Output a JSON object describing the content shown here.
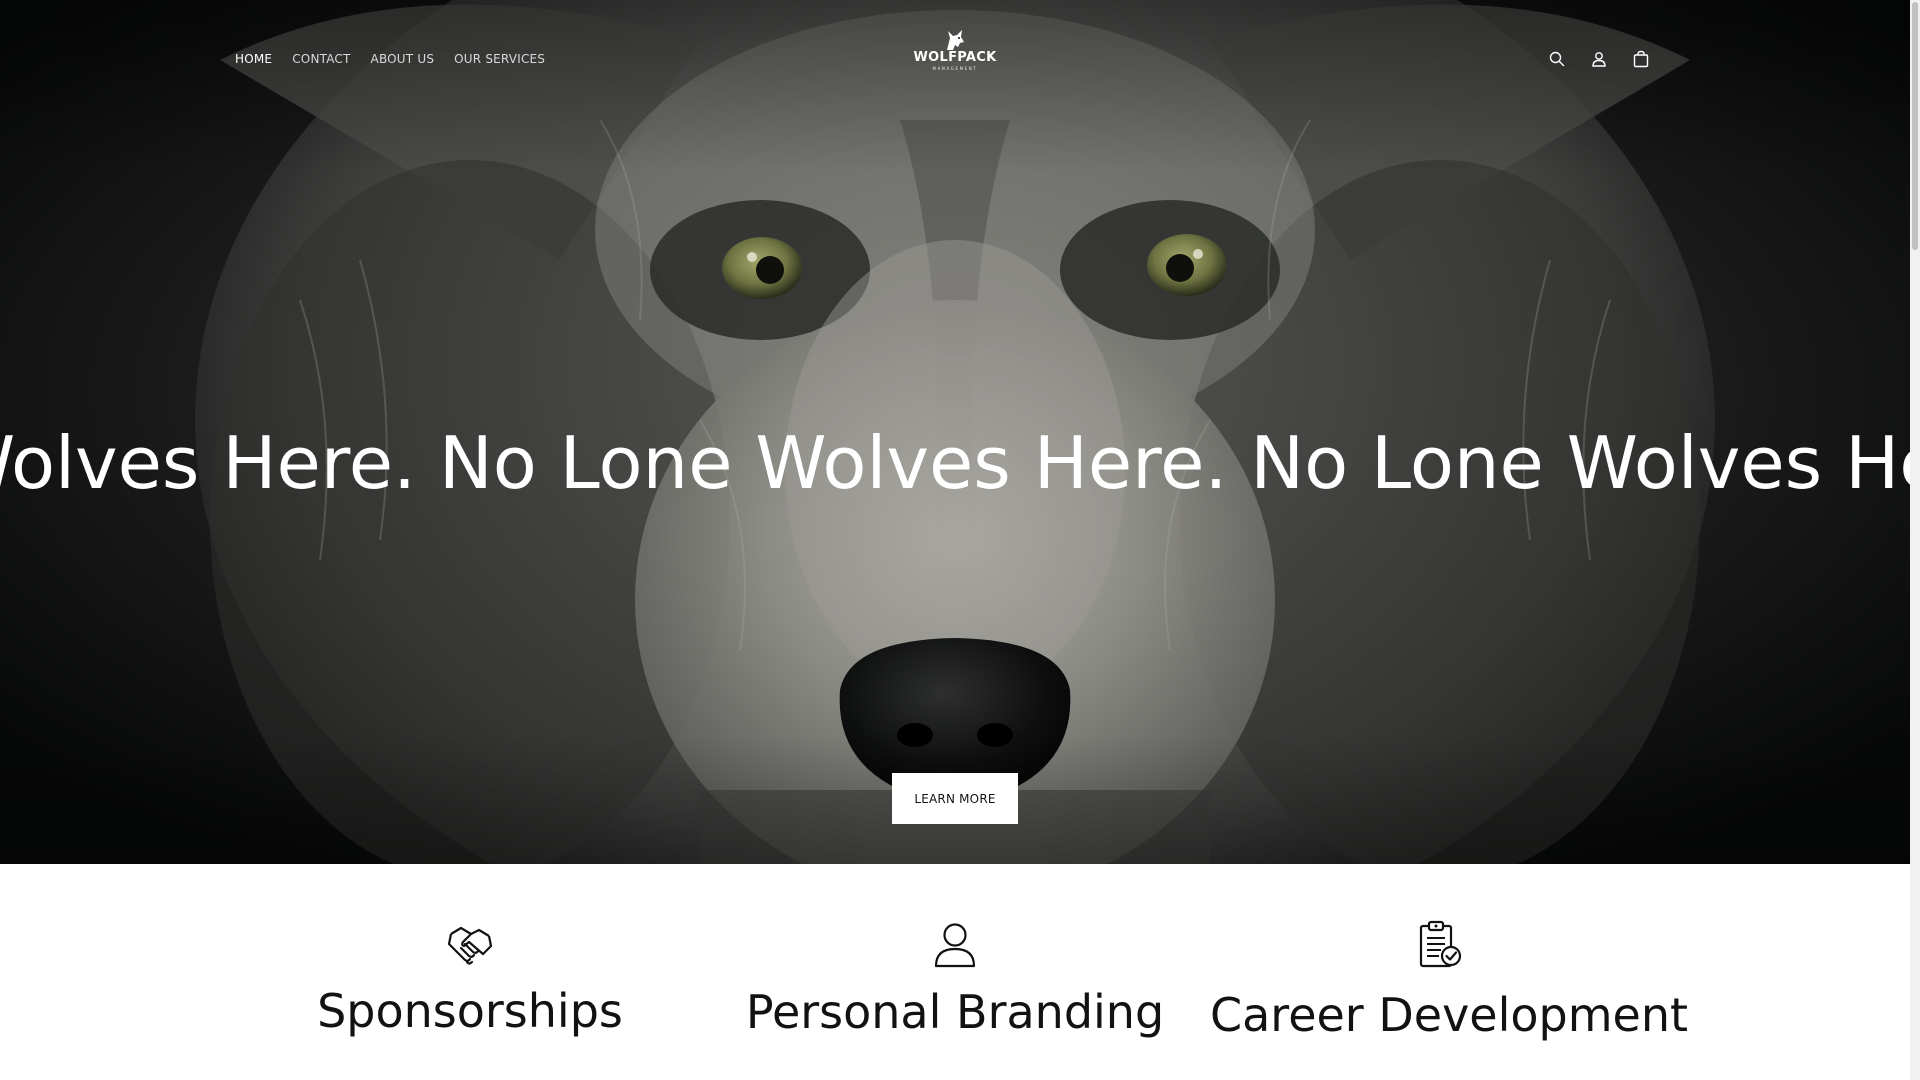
{
  "header": {
    "nav": [
      {
        "label": "HOME",
        "active": true
      },
      {
        "label": "CONTACT",
        "active": false
      },
      {
        "label": "ABOUT US",
        "active": false
      },
      {
        "label": "OUR SERVICES",
        "active": false
      }
    ],
    "logo": {
      "wordmark": "WOLFPACK",
      "subtitle": "MANAGEMENT",
      "icon": "wolf-head-icon"
    },
    "icons": [
      "search-icon",
      "account-icon",
      "cart-icon"
    ]
  },
  "hero": {
    "image": "wolf-face-closeup",
    "marquee_text": "No Lone Wolves Here.",
    "visible_marquee": "Wolves Here. No Lone Wolves Here. No Lone Wolves Here. N",
    "cta_label": "LEARN MORE"
  },
  "services": [
    {
      "title": "Sponsorships",
      "icon": "handshake-icon"
    },
    {
      "title": "Personal Branding",
      "icon": "person-icon"
    },
    {
      "title": "Career Development",
      "icon": "clipboard-check-icon"
    }
  ],
  "colors": {
    "text_dark": "#121212",
    "hero_overlay_text": "#ffffff",
    "button_bg": "#ffffff",
    "background": "#ffffff"
  }
}
